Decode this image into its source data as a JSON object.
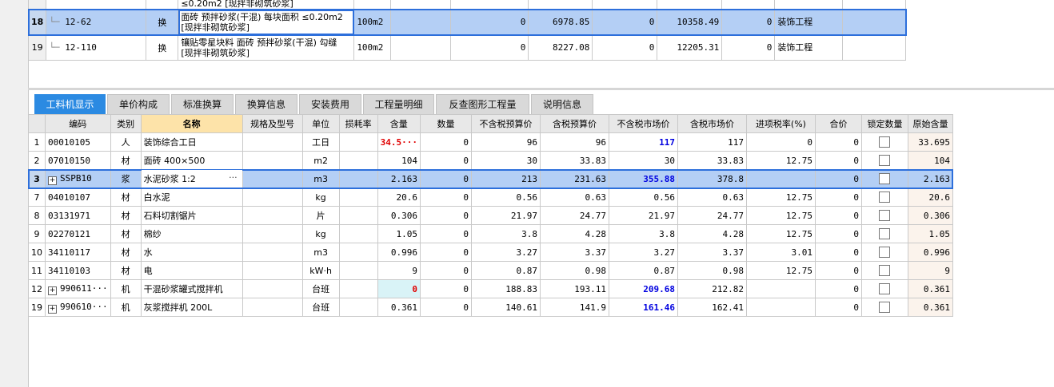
{
  "top_table": {
    "rows": [
      {
        "rn": "18",
        "code": "12-62",
        "swap": "换",
        "name": "面砖 预拌砂浆(干混) 每块面积 ≤0.20m2 [现拌非砌筑砂浆]",
        "unit": "100m2",
        "c1": "",
        "c2": "0",
        "c3": "6978.85",
        "c4": "0",
        "c5": "10358.49",
        "c6": "0",
        "major": "装饰工程",
        "selected": true
      },
      {
        "rn": "19",
        "code": "12-110",
        "swap": "换",
        "name": "镶贴零星块料 面砖 预拌砂浆(干混) 勾缝 [现拌非砌筑砂浆]",
        "unit": "100m2",
        "c1": "",
        "c2": "0",
        "c3": "8227.08",
        "c4": "0",
        "c5": "12205.31",
        "c6": "0",
        "major": "装饰工程",
        "selected": false
      }
    ],
    "partial_row_text": "≤0.20m2 [现拌非砌筑砂浆]"
  },
  "tabs": [
    {
      "label": "工料机显示",
      "active": true
    },
    {
      "label": "单价构成",
      "active": false
    },
    {
      "label": "标准换算",
      "active": false
    },
    {
      "label": "换算信息",
      "active": false
    },
    {
      "label": "安装费用",
      "active": false
    },
    {
      "label": "工程量明细",
      "active": false
    },
    {
      "label": "反查图形工程量",
      "active": false
    },
    {
      "label": "说明信息",
      "active": false
    }
  ],
  "grid": {
    "headers": [
      "",
      "编码",
      "类别",
      "名称",
      "规格及型号",
      "单位",
      "损耗率",
      "含量",
      "数量",
      "不含税预算价",
      "含税预算价",
      "不含税市场价",
      "含税市场价",
      "进项税率(%)",
      "合价",
      "锁定数量",
      "原始含量"
    ],
    "rows": [
      {
        "rn": "1",
        "code": "00010105",
        "type": "人",
        "name": "装饰综合工日",
        "spec": "",
        "unit": "工日",
        "loss": "",
        "content": "34.5···",
        "qty": "0",
        "p1": "96",
        "p2": "96",
        "p3": "117",
        "p4": "117",
        "tax": "0",
        "total": "0",
        "orig": "33.695",
        "content_red": true,
        "expand": false
      },
      {
        "rn": "2",
        "code": "07010150",
        "type": "材",
        "name": "面砖 400×500",
        "spec": "",
        "unit": "m2",
        "loss": "",
        "content": "104",
        "qty": "0",
        "p1": "30",
        "p2": "33.83",
        "p3": "30",
        "p4": "33.83",
        "tax": "12.75",
        "total": "0",
        "orig": "104"
      },
      {
        "rn": "3",
        "code": "SSPB10",
        "type": "浆",
        "name": "水泥砂浆 1:2",
        "spec": "",
        "unit": "m3",
        "loss": "",
        "content": "2.163",
        "qty": "0",
        "p1": "213",
        "p2": "231.63",
        "p3": "355.88",
        "p4": "378.8",
        "tax": "",
        "total": "0",
        "orig": "2.163",
        "selected": true,
        "expand": true,
        "p3_blue": true
      },
      {
        "rn": "7",
        "code": "04010107",
        "type": "材",
        "name": "白水泥",
        "spec": "",
        "unit": "kg",
        "loss": "",
        "content": "20.6",
        "qty": "0",
        "p1": "0.56",
        "p2": "0.63",
        "p3": "0.56",
        "p4": "0.63",
        "tax": "12.75",
        "total": "0",
        "orig": "20.6"
      },
      {
        "rn": "8",
        "code": "03131971",
        "type": "材",
        "name": "石料切割锯片",
        "spec": "",
        "unit": "片",
        "loss": "",
        "content": "0.306",
        "qty": "0",
        "p1": "21.97",
        "p2": "24.77",
        "p3": "21.97",
        "p4": "24.77",
        "tax": "12.75",
        "total": "0",
        "orig": "0.306"
      },
      {
        "rn": "9",
        "code": "02270121",
        "type": "材",
        "name": "棉纱",
        "spec": "",
        "unit": "kg",
        "loss": "",
        "content": "1.05",
        "qty": "0",
        "p1": "3.8",
        "p2": "4.28",
        "p3": "3.8",
        "p4": "4.28",
        "tax": "12.75",
        "total": "0",
        "orig": "1.05"
      },
      {
        "rn": "10",
        "code": "34110117",
        "type": "材",
        "name": "水",
        "spec": "",
        "unit": "m3",
        "loss": "",
        "content": "0.996",
        "qty": "0",
        "p1": "3.27",
        "p2": "3.37",
        "p3": "3.27",
        "p4": "3.37",
        "tax": "3.01",
        "total": "0",
        "orig": "0.996"
      },
      {
        "rn": "11",
        "code": "34110103",
        "type": "材",
        "name": "电",
        "spec": "",
        "unit": "kW·h",
        "loss": "",
        "content": "9",
        "qty": "0",
        "p1": "0.87",
        "p2": "0.98",
        "p3": "0.87",
        "p4": "0.98",
        "tax": "12.75",
        "total": "0",
        "orig": "9"
      },
      {
        "rn": "12",
        "code": "990611···",
        "type": "机",
        "name": "干混砂浆罐式搅拌机",
        "spec": "",
        "unit": "台班",
        "loss": "",
        "content": "0",
        "qty": "0",
        "p1": "188.83",
        "p2": "193.11",
        "p3": "209.68",
        "p4": "212.82",
        "tax": "",
        "total": "0",
        "orig": "0.361",
        "expand": true,
        "content_red": true,
        "content_hl": true,
        "p3_blue": true
      },
      {
        "rn": "19",
        "code": "990610···",
        "type": "机",
        "name": "灰浆搅拌机 200L",
        "spec": "",
        "unit": "台班",
        "loss": "",
        "content": "0.361",
        "qty": "0",
        "p1": "140.61",
        "p2": "141.9",
        "p3": "161.46",
        "p4": "162.41",
        "tax": "",
        "total": "0",
        "orig": "0.361",
        "expand": true,
        "p3_blue": true
      }
    ]
  },
  "colors": {
    "accent": "#2b8ae2",
    "selection": "#b4cff5",
    "header_highlight": "#fde3a9",
    "red_value": "#e00000",
    "blue_value": "#0000e0"
  }
}
